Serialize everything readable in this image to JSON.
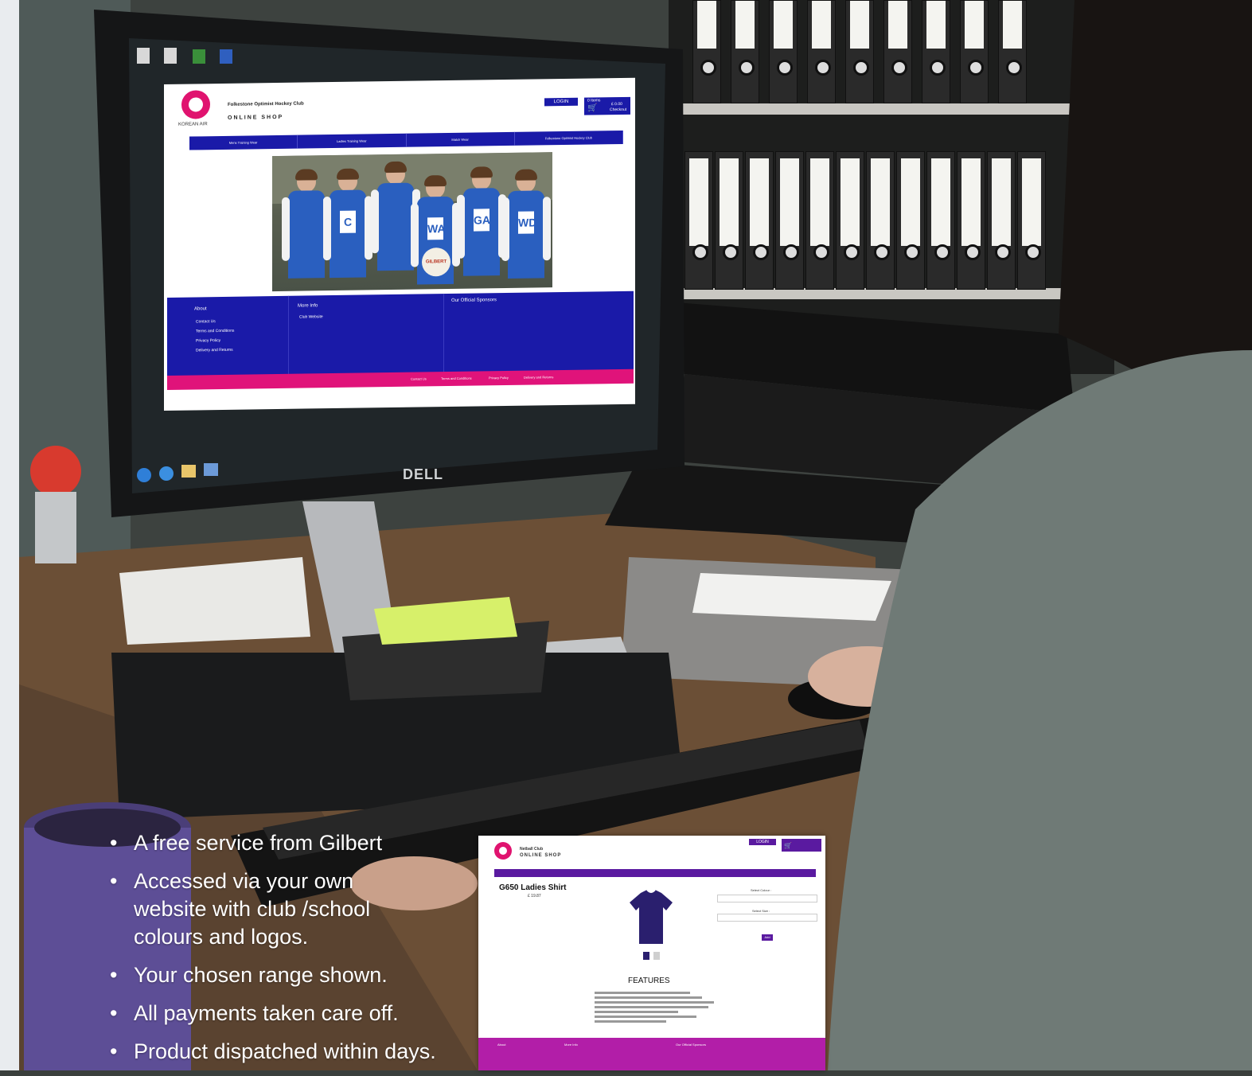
{
  "website": {
    "brand": "KOREAN AIR",
    "club_name": "Folkestone Optimist Hockey Club",
    "shop_title": "ONLINE SHOP",
    "login_label": "LOGIN",
    "cart_items": "0 Items",
    "cart_total": "£ 0.00",
    "checkout_label": "Checkout",
    "nav": [
      "Mens Training Wear",
      "Ladies Training Wear",
      "Match Wear",
      "Folkestone Optimist Hockey Club"
    ],
    "footer": {
      "about_heading": "About",
      "about_links": [
        "Contact Us",
        "Terms and Conditions",
        "Privacy Policy",
        "Delivery and Returns"
      ],
      "more_heading": "More Info",
      "more_links": [
        "Club Website"
      ],
      "sponsors_heading": "Our Official Sponsors"
    },
    "bottom_links": [
      "Contact Us",
      "Terms and Conditions",
      "Privacy Policy",
      "Delivery and Returns"
    ],
    "bib_letters": [
      "C",
      "WA",
      "GA",
      "WD"
    ],
    "ball_text": "GILBERT"
  },
  "monitor_brand": "DELL",
  "product_page": {
    "club_name": "Netball Club",
    "shop_title": "ONLINE SHOP",
    "login_label": "LOGIN",
    "title": "G650 Ladies Shirt",
    "price": "£ 19.87",
    "features_heading": "FEATURES",
    "select_colour": "Select Colour :",
    "select_size": "Select Size :",
    "add_label": "Add",
    "footer": [
      "About",
      "More Info",
      "Our Official Sponsors"
    ]
  },
  "bullets": [
    "A free service from Gilbert",
    "Accessed via your own website with club /school colours and logos.",
    "Your chosen range shown.",
    "All payments taken care off.",
    "Product dispatched within days."
  ],
  "colors": {
    "site_blue": "#1a1aa8",
    "site_pink": "#e0137a",
    "product_purple": "#b21ea8",
    "mug_purple": "#5d4e96"
  }
}
